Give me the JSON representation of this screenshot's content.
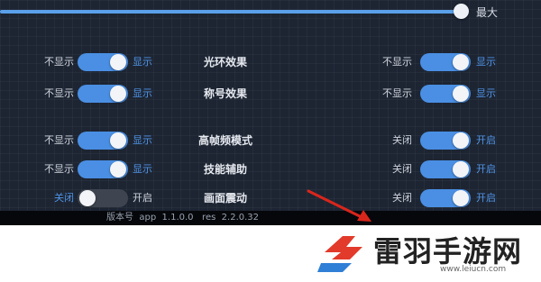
{
  "slider": {
    "max_label": "最大",
    "level": 1.0
  },
  "rows": [
    {
      "feature": "光环效果",
      "left": {
        "off": "不显示",
        "on": "显示",
        "state": "on"
      },
      "right": {
        "off": "不显示",
        "on": "显示",
        "state": "on"
      }
    },
    {
      "feature": "称号效果",
      "left": {
        "off": "不显示",
        "on": "显示",
        "state": "on"
      },
      "right": {
        "off": "不显示",
        "on": "显示",
        "state": "on"
      }
    },
    {
      "feature": "高帧频模式",
      "left": {
        "off": "不显示",
        "on": "显示",
        "state": "on"
      },
      "right": {
        "off": "关闭",
        "on": "开启",
        "state": "on"
      }
    },
    {
      "feature": "技能辅助",
      "left": {
        "off": "不显示",
        "on": "显示",
        "state": "on"
      },
      "right": {
        "off": "关闭",
        "on": "开启",
        "state": "on"
      }
    },
    {
      "feature": "画面震动",
      "left": {
        "off": "关闭",
        "on": "开启",
        "state": "off"
      },
      "right": {
        "off": "关闭",
        "on": "开启",
        "state": "on"
      }
    }
  ],
  "version": {
    "text": "版本号  app  1.1.0.0   res  2.2.0.32"
  },
  "brand": {
    "name": "雷羽手游网",
    "url": "www.leiucn.com"
  },
  "colors": {
    "accent": "#4a8fe3",
    "panel_bg": "#1d2533",
    "arrow": "#d9261c",
    "logo_red": "#e23a2b",
    "logo_blue": "#2f7fd6"
  }
}
